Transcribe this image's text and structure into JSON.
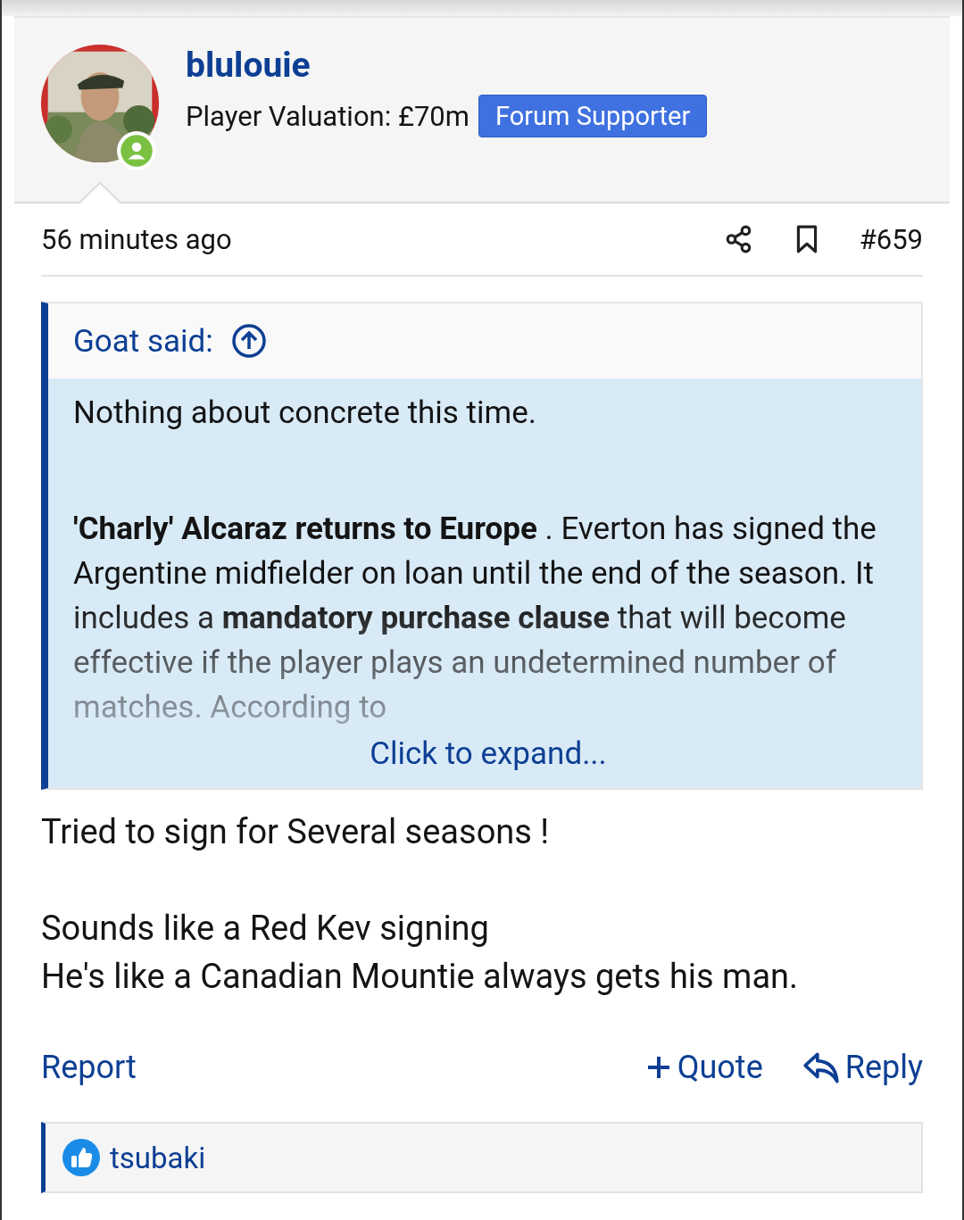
{
  "user": {
    "name": "blulouie",
    "valuation": "Player Valuation: £70m",
    "badge": "Forum Supporter",
    "online": true
  },
  "post": {
    "time": "56 minutes ago",
    "number": "#659"
  },
  "quote": {
    "author": "Goat said:",
    "paragraphs": [
      "Nothing about concrete this time.",
      "**'Charly' Alcaraz returns to Europe** . Everton has signed the Argentine midfielder on loan until the end of the season. It includes a **mandatory purchase clause** that will become effective if the player plays an undetermined number of matches. According to"
    ],
    "expand": "Click to expand..."
  },
  "message": {
    "paragraphs": [
      [
        "Tried to sign for Several seasons !"
      ],
      [
        "Sounds like a Red Kev signing",
        "He's like a Canadian Mountie always gets his man."
      ]
    ]
  },
  "actions": {
    "report": "Report",
    "quote": "Quote",
    "reply": "Reply"
  },
  "reactions": {
    "users": "tsubaki"
  }
}
